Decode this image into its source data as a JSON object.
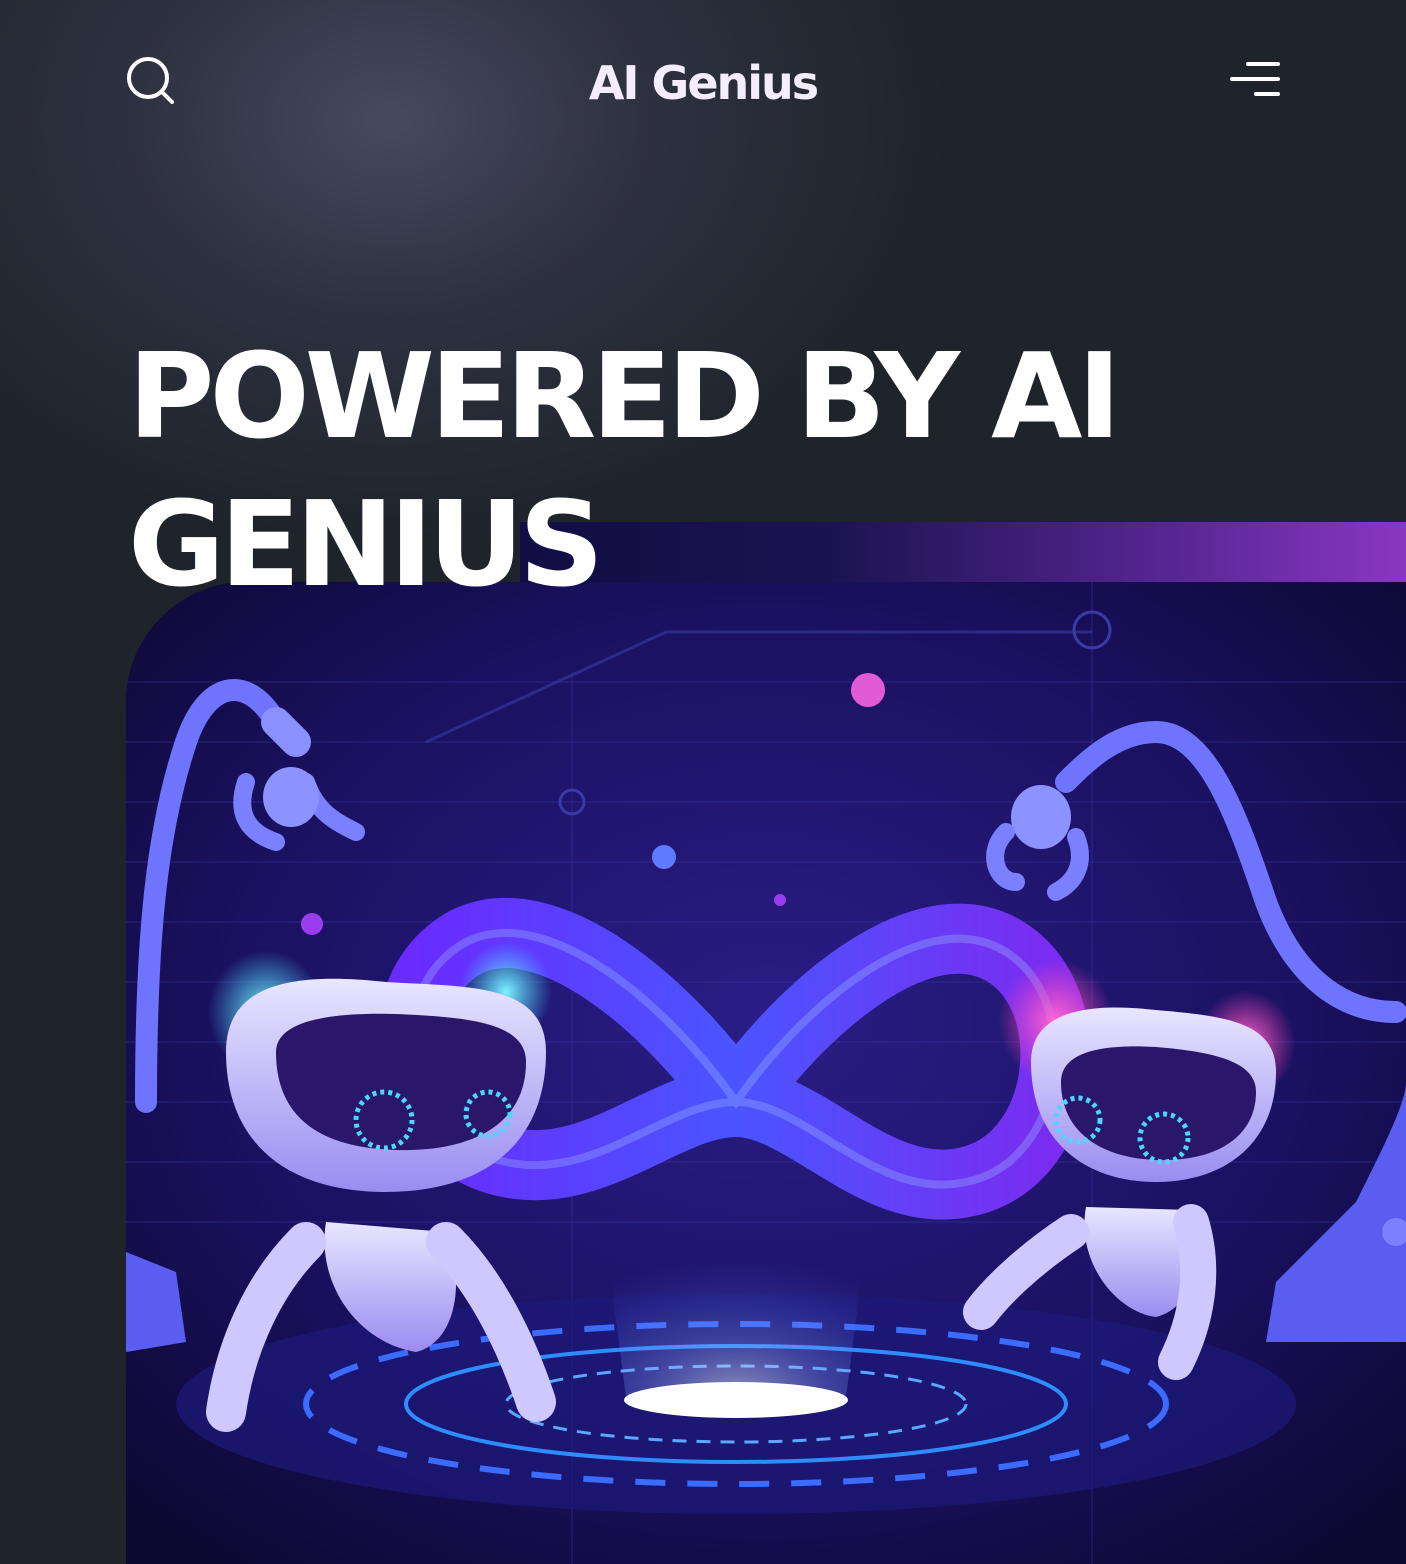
{
  "header": {
    "brand": "AI Genius",
    "search_icon": "search-icon",
    "menu_icon": "hamburger-menu-icon"
  },
  "hero": {
    "headline_line1": "POWERED BY AI",
    "headline_line2": "GENIUS",
    "illustration": "robots-infinity-illustration"
  },
  "colors": {
    "background": "#1f242b",
    "accent_purple": "#8a37c2",
    "illustration_navy": "#120c3d",
    "brand_text": "#f4ecff"
  }
}
